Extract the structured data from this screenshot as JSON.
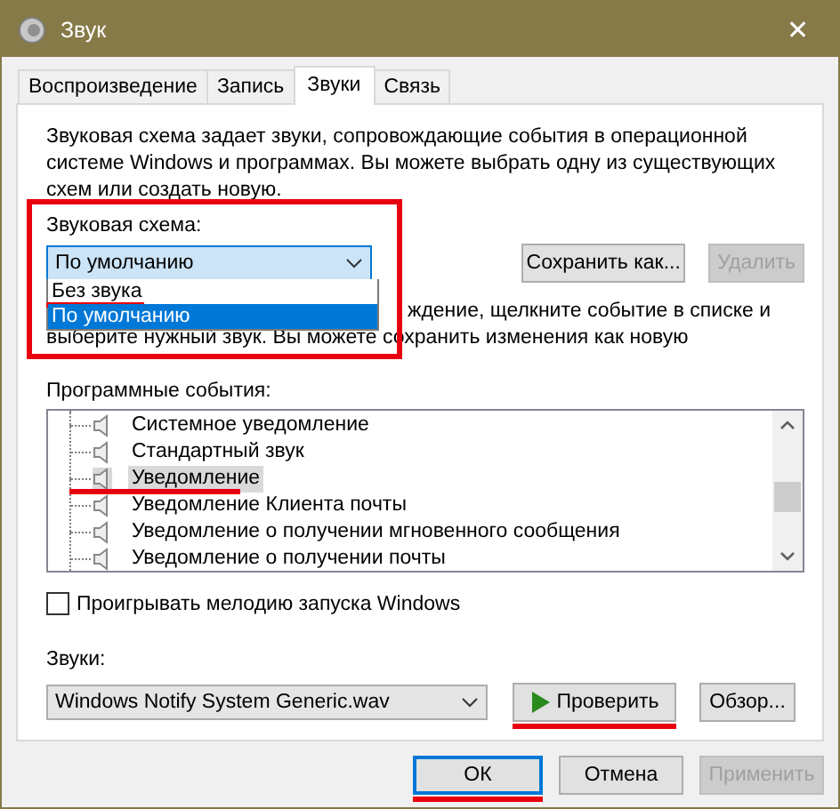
{
  "window": {
    "title": "Звук",
    "close": "✕"
  },
  "tabs": [
    {
      "label": "Воспроизведение",
      "selected": false
    },
    {
      "label": "Запись",
      "selected": false
    },
    {
      "label": "Звуки",
      "selected": true
    },
    {
      "label": "Связь",
      "selected": false
    }
  ],
  "intro": "Звуковая схема задает звуки, сопровождающие события в операционной системе Windows и программах. Вы можете выбрать одну из существующих схем или создать новую.",
  "scheme": {
    "label": "Звуковая схема:",
    "highlighted": true,
    "value": "По умолчанию",
    "expanded": true,
    "options": [
      {
        "label": "Без звука",
        "selected": false,
        "underlined": true
      },
      {
        "label": "По умолчанию",
        "selected": true,
        "underlined": false
      }
    ],
    "buttons": [
      {
        "label": "Сохранить как...",
        "disabled": false
      },
      {
        "label": "Удалить",
        "disabled": true
      }
    ]
  },
  "hint_lines": [
    "ждение, щелкните событие в списке и",
    "выберите нужный звук. Вы можете сохранить изменения как новую"
  ],
  "events": {
    "label": "Программные события:",
    "items": [
      {
        "label": "Системное уведомление",
        "selected": false,
        "underlined": false
      },
      {
        "label": "Стандартный звук",
        "selected": false,
        "underlined": false
      },
      {
        "label": "Уведомление",
        "selected": true,
        "underlined": true
      },
      {
        "label": "Уведомление Клиента почты",
        "selected": false,
        "underlined": false
      },
      {
        "label": "Уведомление о получении мгновенного сообщения",
        "selected": false,
        "underlined": false
      },
      {
        "label": "Уведомление о получении почты",
        "selected": false,
        "underlined": false
      }
    ]
  },
  "startup": {
    "label": "Проигрывать мелодию запуска Windows",
    "checked": false
  },
  "sounds": {
    "label": "Звуки:",
    "value": "Windows Notify System Generic.wav",
    "buttons": [
      {
        "label": "Проверить",
        "kind": "play",
        "underlined": true
      },
      {
        "label": "Обзор...",
        "kind": "plain",
        "underlined": false
      }
    ]
  },
  "footer": [
    {
      "label": "ОК",
      "default": true,
      "disabled": false,
      "underlined": true
    },
    {
      "label": "Отмена",
      "default": false,
      "disabled": false,
      "underlined": false
    },
    {
      "label": "Применить",
      "default": false,
      "disabled": true,
      "underlined": false
    }
  ]
}
